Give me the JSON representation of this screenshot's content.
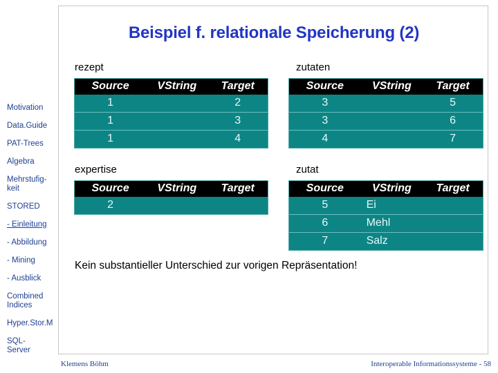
{
  "slide": {
    "title": "Beispiel f. relationale Speicherung (2)",
    "conclusion": "Kein substantieller Unterschied zur vorigen Repräsentation!"
  },
  "sidebar": {
    "items": [
      {
        "label": "Motivation",
        "current": false
      },
      {
        "label": "Data.Guide",
        "current": false
      },
      {
        "label": "PAT-Trees",
        "current": false
      },
      {
        "label": "Algebra",
        "current": false
      },
      {
        "label": "Mehrstufig-\nkeit",
        "current": false
      },
      {
        "label": "STORED",
        "current": false
      },
      {
        "label": "- Einleitung",
        "current": true
      },
      {
        "label": "- Abbildung",
        "current": false
      },
      {
        "label": "- Mining",
        "current": false
      },
      {
        "label": "- Ausblick",
        "current": false
      },
      {
        "label": "Combined\nIndices",
        "current": false
      },
      {
        "label": "Hyper.Stor.M",
        "current": false
      },
      {
        "label": "SQL-\nServer",
        "current": false
      }
    ]
  },
  "tables": {
    "columns": [
      "Source",
      "VString",
      "Target"
    ],
    "rezept": {
      "caption": "rezept",
      "rows": [
        [
          "1",
          "",
          "2"
        ],
        [
          "1",
          "",
          "3"
        ],
        [
          "1",
          "",
          "4"
        ]
      ]
    },
    "zutaten": {
      "caption": "zutaten",
      "rows": [
        [
          "3",
          "",
          "5"
        ],
        [
          "3",
          "",
          "6"
        ],
        [
          "4",
          "",
          "7"
        ]
      ]
    },
    "expertise": {
      "caption": "expertise",
      "rows": [
        [
          "2",
          "",
          ""
        ]
      ]
    },
    "zutat": {
      "caption": "zutat",
      "rows": [
        [
          "5",
          "Ei",
          ""
        ],
        [
          "6",
          "Mehl",
          ""
        ],
        [
          "7",
          "Salz",
          ""
        ]
      ]
    }
  },
  "footer": {
    "author": "Klemens Böhm",
    "course": "Interoperable Informationssysteme - 58"
  },
  "colors": {
    "title": "#2236c4",
    "nav": "#1f3f8f",
    "table_body": "#0d8585",
    "table_header": "#000000",
    "frame": "#c8c8c8"
  }
}
